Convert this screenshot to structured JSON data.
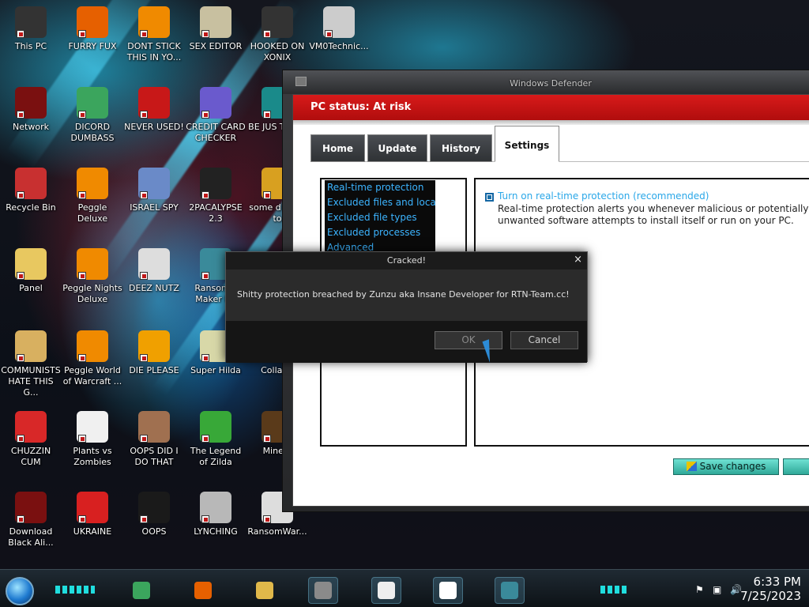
{
  "desktop": {
    "icons": [
      {
        "label": "This PC",
        "icon": "computer-icon",
        "color": "#333333"
      },
      {
        "label": "FURRY FUX",
        "icon": "firefox-icon",
        "color": "#e66000"
      },
      {
        "label": "DONT STICK THIS IN YO...",
        "icon": "vlc-cone-icon",
        "color": "#f08a00"
      },
      {
        "label": "SEX EDITOR",
        "icon": "hxd-editor-icon",
        "color": "#c8c0a0"
      },
      {
        "label": "HOOKED ON XONIX",
        "icon": "xonix-game-icon",
        "color": "#333333"
      },
      {
        "label": "VM0Technic...",
        "icon": "doctor-icon",
        "color": "#cccccc"
      },
      {
        "label": "Network",
        "icon": "network-orb-icon",
        "color": "#7a1010"
      },
      {
        "label": "DICORD DUMBASS",
        "icon": "discord-icon",
        "color": "#3ba55d"
      },
      {
        "label": "NEVER USED!",
        "icon": "devcpp-icon",
        "color": "#c81818"
      },
      {
        "label": "CREDIT CARD CHECKER",
        "icon": "credit-card-icon",
        "color": "#6a5acd"
      },
      {
        "label": "BE JUS THE D",
        "icon": "app-icon",
        "color": "#1a8a8a"
      },
      {
        "label": "Recycle Bin",
        "icon": "recycle-bin-icon",
        "color": "#c83030"
      },
      {
        "label": "Peggle Deluxe",
        "icon": "peggle-icon",
        "color": "#f08a00"
      },
      {
        "label": "ISRAEL SPY",
        "icon": "spy-app-icon",
        "color": "#6a8ac8"
      },
      {
        "label": "2PACALYPSE 2.3",
        "icon": "console-icon",
        "color": "#222222"
      },
      {
        "label": "some d need to",
        "icon": "dog-icon",
        "color": "#d8a020"
      },
      {
        "label": "Panel",
        "icon": "star-butterfly-icon",
        "color": "#e8c860"
      },
      {
        "label": "Peggle Nights Deluxe",
        "icon": "peggle-nights-icon",
        "color": "#f08a00"
      },
      {
        "label": "DEEZ NUTZ",
        "icon": "windows-stack-icon",
        "color": "#dddddd"
      },
      {
        "label": "Ransomw Maker Bu",
        "icon": "window-app-icon",
        "color": "#3a8a9a"
      },
      {
        "label": "COMMUNISTS HATE THIS G...",
        "icon": "money-bag-icon",
        "color": "#d8b060"
      },
      {
        "label": "Peggle World of Warcraft ...",
        "icon": "peggle-wow-icon",
        "color": "#f08a00"
      },
      {
        "label": "DIE PLEASE",
        "icon": "adobe-de-icon",
        "color": "#f0a000"
      },
      {
        "label": "Super Hilda",
        "icon": "pixel-game-icon",
        "color": "#d8d8a8"
      },
      {
        "label": "CollabV",
        "icon": "collab-icon",
        "color": "#4a4a4a"
      },
      {
        "label": "CHUZZIN CUM",
        "icon": "chuzzle-icon",
        "color": "#d82828"
      },
      {
        "label": "Plants vs Zombies",
        "icon": "pvz-flower-icon",
        "color": "#f0f0f0"
      },
      {
        "label": "OOPS DID I DO THAT",
        "icon": "portrait-icon",
        "color": "#a07050"
      },
      {
        "label": "The Legend of Zilda",
        "icon": "zelda-sprite-icon",
        "color": "#38a838"
      },
      {
        "label": "Minecr",
        "icon": "minecraft-icon",
        "color": "#5a3a1a"
      },
      {
        "label": "Download Black Ali...",
        "icon": "red-orb-icon",
        "color": "#7a1010"
      },
      {
        "label": "UKRAINE",
        "icon": "radiation-icon",
        "color": "#d82020"
      },
      {
        "label": "OOPS",
        "icon": "oops-app-icon",
        "color": "#1a1a1a"
      },
      {
        "label": "LYNCHING",
        "icon": "gear-flag-icon",
        "color": "#b8b8b8"
      },
      {
        "label": "RansomWar...",
        "icon": "skull-icon",
        "color": "#dddddd"
      }
    ]
  },
  "defender": {
    "window_title": "Windows Defender",
    "status": "PC status: At risk",
    "tabs": [
      "Home",
      "Update",
      "History",
      "Settings"
    ],
    "active_tab": "Settings",
    "settings_nav": [
      "Real-time protection",
      "Excluded files and locat...",
      "Excluded file types",
      "Excluded processes",
      "Advanced"
    ],
    "realtime_checkbox_label": "Turn on real-time protection (recommended)",
    "realtime_description": "Real-time protection alerts you whenever malicious or potentially unwanted software attempts to install itself or run on your PC.",
    "save_button": "Save changes",
    "status_color": "#d21616"
  },
  "dialog": {
    "title": "Cracked!",
    "close_glyph": "×",
    "message": "Shitty protection breached by Zunzu aka Insane Developer for RTN-Team.cc!",
    "ok_label": "OK",
    "cancel_label": "Cancel"
  },
  "taskbar": {
    "apps": [
      "discord-icon",
      "firefox-icon",
      "file-explorer-icon",
      "brick-wall-icon",
      "pixel-character-icon",
      "xonix-icon",
      "window-app-icon"
    ],
    "clock_time": "6:33 PM",
    "clock_date": "7/25/2023",
    "tray_icons": [
      "flag-icon",
      "network-icon",
      "volume-icon"
    ]
  }
}
